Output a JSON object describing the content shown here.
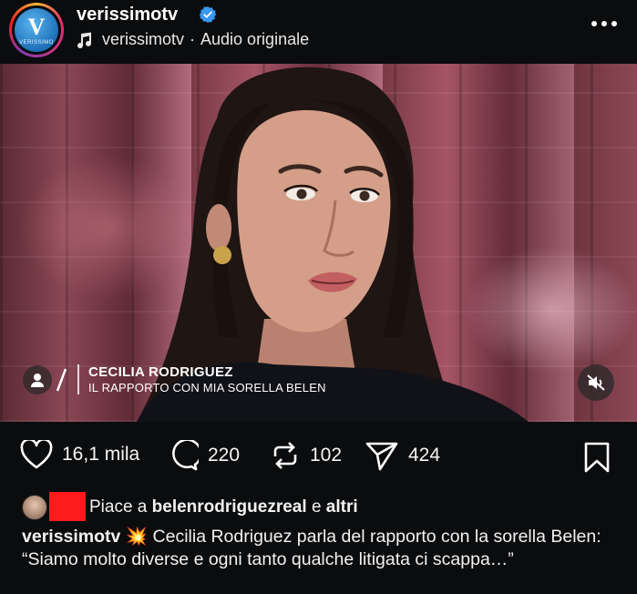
{
  "header": {
    "avatar_text": "V",
    "avatar_subtext": "VERISSIMO",
    "username": "verissimotv",
    "audio_user": "verissimotv",
    "audio_separator": "·",
    "audio_label": "Audio originale",
    "icons": {
      "verified": "verified-badge-icon",
      "audio": "music-note-icon",
      "more": "more-options-icon"
    }
  },
  "video": {
    "lower_third_name": "CECILIA RODRIGUEZ",
    "lower_third_subtitle": "IL RAPPORTO CON MIA SORELLA BELEN",
    "icons": {
      "speaker": "person-icon",
      "mute": "muted-speaker-icon"
    }
  },
  "actions": {
    "likes": "16,1 mila",
    "comments": "220",
    "reposts": "102",
    "shares": "424",
    "icons": [
      "heart-icon",
      "comment-icon",
      "repost-icon",
      "share-icon",
      "bookmark-icon"
    ]
  },
  "liked_by": {
    "prefix": "Piace a",
    "user": "belenrodriguezreal",
    "connector": "e",
    "others": "altri"
  },
  "caption": {
    "user": "verissimotv",
    "emoji": "💥",
    "text": "Cecilia Rodriguez parla del rapporto con la sorella Belen: “Siamo molto diverse e ogni tanto qualche litigata ci scappa…”"
  },
  "colors": {
    "background": "#0b0c0e",
    "verified_blue": "#3897f0",
    "redaction_red": "#ff1b1b"
  }
}
